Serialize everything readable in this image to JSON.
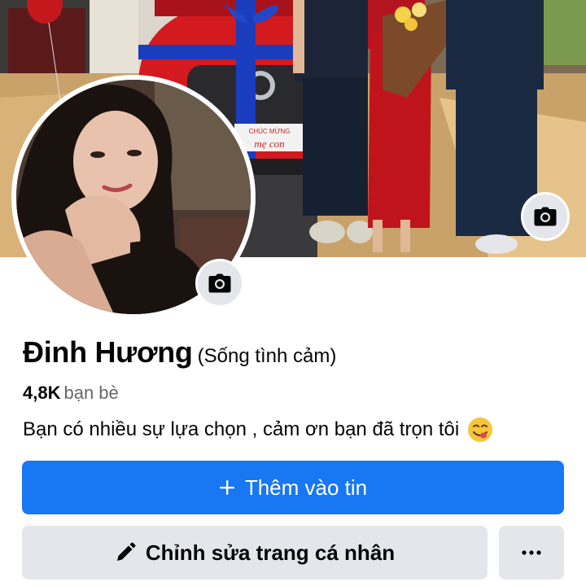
{
  "profile": {
    "name": "Đinh Hương",
    "nickname": "(Sống tình cảm)",
    "friends_count": "4,8K",
    "friends_label": "bạn bè",
    "bio": "Bạn có nhiều sự lựa chọn , cảm ơn bạn đã trọn tôi",
    "bio_emoji": "face-savoring-food-emoji"
  },
  "cover": {
    "camera_icon": "camera-icon",
    "plate_line1": "CHÚC MỪNG",
    "plate_line2": "mẹ con"
  },
  "avatar": {
    "camera_icon": "camera-icon"
  },
  "actions": {
    "add_story_icon": "plus-icon",
    "add_story_label": "Thêm vào tin",
    "edit_profile_icon": "pencil-icon",
    "edit_profile_label": "Chỉnh sửa trang cá nhân",
    "more_icon": "more-horizontal-icon",
    "more_label": "···"
  },
  "colors": {
    "primary": "#1877f2",
    "secondary_button": "#e4e6eb",
    "text_primary": "#050505",
    "text_secondary": "#65676b"
  }
}
